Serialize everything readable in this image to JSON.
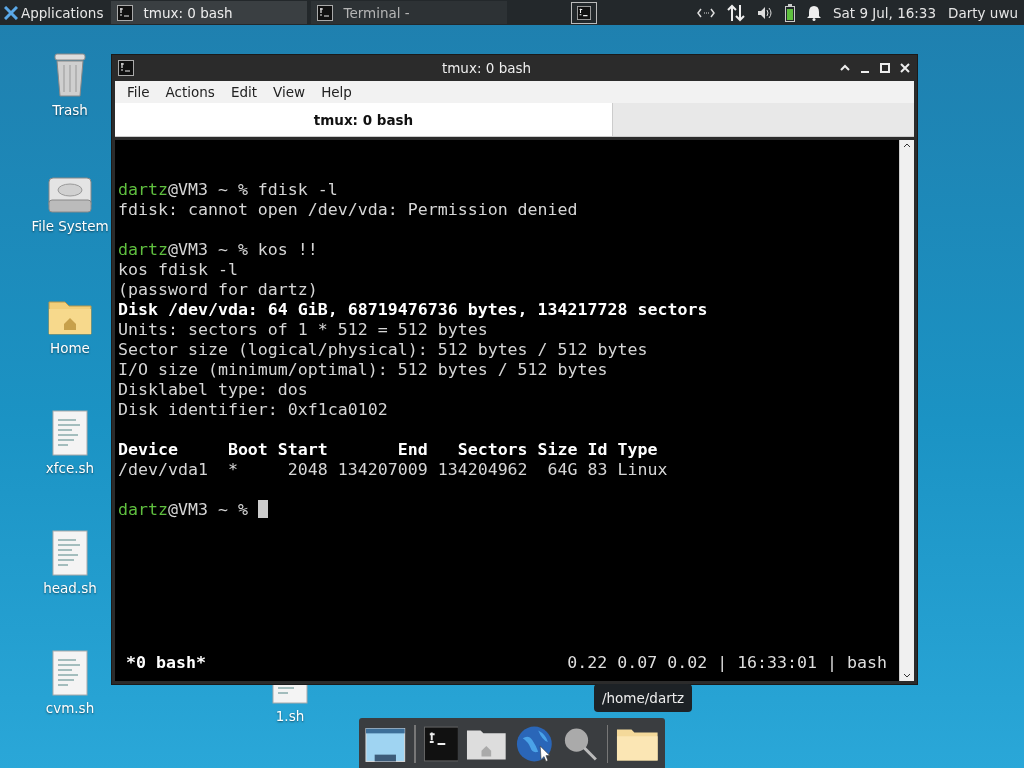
{
  "panel": {
    "menu": "Applications",
    "tasks": [
      {
        "title": "tmux: 0 bash",
        "selected": true
      },
      {
        "title": "Terminal -",
        "selected": false
      }
    ],
    "clock": "Sat  9 Jul, 16:33",
    "user": "Darty uwu"
  },
  "desktop_icons": [
    {
      "label": "Trash",
      "kind": "trash"
    },
    {
      "label": "File System",
      "kind": "drive"
    },
    {
      "label": "Home",
      "kind": "home"
    },
    {
      "label": "xfce.sh",
      "kind": "script"
    },
    {
      "label": "head.sh",
      "kind": "script"
    },
    {
      "label": "cvm.sh",
      "kind": "script"
    },
    {
      "label": "1.sh",
      "kind": "script"
    }
  ],
  "window": {
    "title": "tmux: 0 bash",
    "menu": [
      "File",
      "Actions",
      "Edit",
      "View",
      "Help"
    ],
    "tabs": [
      {
        "label": "tmux: 0 bash",
        "selected": true
      }
    ],
    "lines": [
      {
        "kind": "blank"
      },
      {
        "kind": "blank"
      },
      {
        "kind": "prompt",
        "user": "dartz",
        "rest": "@VM3 ~ % fdisk -l"
      },
      {
        "kind": "output",
        "text": "fdisk: cannot open /dev/vda: Permission denied"
      },
      {
        "kind": "blank"
      },
      {
        "kind": "prompt",
        "user": "dartz",
        "rest": "@VM3 ~ % kos !!"
      },
      {
        "kind": "output",
        "text": "kos fdisk -l"
      },
      {
        "kind": "output",
        "text": "(password for dartz)"
      },
      {
        "kind": "bold",
        "text": "Disk /dev/vda: 64 GiB, 68719476736 bytes, 134217728 sectors"
      },
      {
        "kind": "output",
        "text": "Units: sectors of 1 * 512 = 512 bytes"
      },
      {
        "kind": "output",
        "text": "Sector size (logical/physical): 512 bytes / 512 bytes"
      },
      {
        "kind": "output",
        "text": "I/O size (minimum/optimal): 512 bytes / 512 bytes"
      },
      {
        "kind": "output",
        "text": "Disklabel type: dos"
      },
      {
        "kind": "output",
        "text": "Disk identifier: 0xf1ca0102"
      },
      {
        "kind": "blank"
      },
      {
        "kind": "bold",
        "text": "Device     Boot Start       End   Sectors Size Id Type"
      },
      {
        "kind": "output",
        "text": "/dev/vda1  *     2048 134207009 134204962  64G 83 Linux"
      },
      {
        "kind": "blank"
      },
      {
        "kind": "prompt",
        "user": "dartz",
        "rest": "@VM3 ~ % ",
        "cursor": true
      }
    ],
    "status_left": "*0 bash*",
    "status_right": "0.22 0.07 0.02 | 16:33:01 | bash"
  },
  "tooltip": "/home/dartz"
}
